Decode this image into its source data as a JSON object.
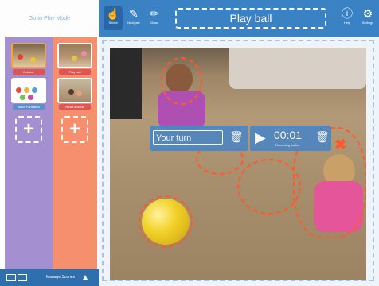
{
  "sidebar": {
    "go_play_label": "Go to Play Mode",
    "scenes": [
      {
        "label": "Outside"
      },
      {
        "label": "Play ball"
      },
      {
        "label": "Make Pancakes"
      },
      {
        "label": "Read a Book"
      }
    ],
    "add_scene_glyph": "+",
    "bottom_label": "Manage Scenes"
  },
  "topbar": {
    "tools": [
      {
        "label": "Select",
        "icon": "hand-pointer-icon"
      },
      {
        "label": "Navigate",
        "icon": "pencil-icon"
      },
      {
        "label": "Draw",
        "icon": "pencil-icon"
      }
    ],
    "title": "Play ball",
    "right_tools": [
      {
        "label": "Help",
        "icon": "help-icon"
      },
      {
        "label": "Settings",
        "icon": "gear-icon"
      }
    ]
  },
  "overlay": {
    "turn_text": "Your turn",
    "time": "00:01",
    "time_sub": "Recording Audio"
  },
  "colors": {
    "topbar": "#3a82c4",
    "purple_column": "#a48fd0",
    "orange_column": "#f58f6e",
    "hotspot": "#ff5a2a"
  }
}
